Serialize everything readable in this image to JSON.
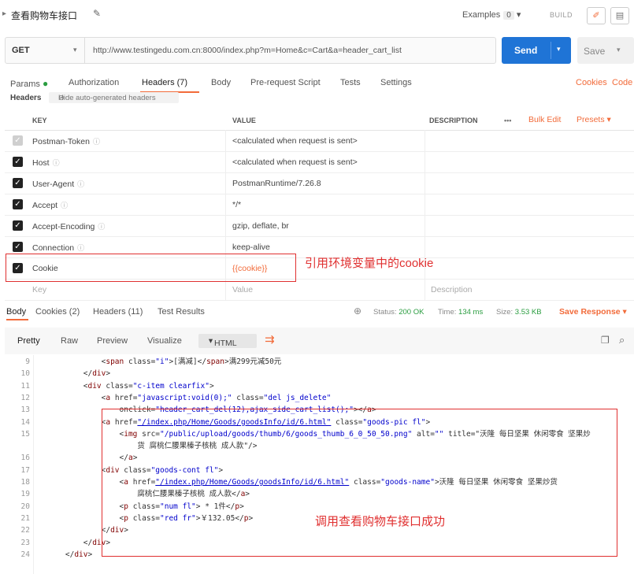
{
  "request": {
    "title": "查看购物车接口",
    "examples_label": "Examples",
    "examples_count": "0",
    "build_label": "BUILD",
    "method": "GET",
    "url": "http://www.testingedu.com.cn:8000/index.php?m=Home&c=Cart&a=header_cart_list",
    "send_label": "Send",
    "save_label": "Save"
  },
  "tabs": {
    "params": "Params",
    "authorization": "Authorization",
    "headers": "Headers (7)",
    "body": "Body",
    "prerequest": "Pre-request Script",
    "tests": "Tests",
    "settings": "Settings",
    "cookies_link": "Cookies",
    "code_link": "Code"
  },
  "headers_section": {
    "label": "Headers",
    "hide_auto": "Hide auto-generated headers"
  },
  "table": {
    "col_key": "KEY",
    "col_value": "VALUE",
    "col_description": "DESCRIPTION",
    "more": "•••",
    "bulk_edit": "Bulk Edit",
    "presets": "Presets",
    "rows": [
      {
        "key": "Postman-Token",
        "value": "<calculated when request is sent>"
      },
      {
        "key": "Host",
        "value": "<calculated when request is sent>"
      },
      {
        "key": "User-Agent",
        "value": "PostmanRuntime/7.26.8"
      },
      {
        "key": "Accept",
        "value": "*/*"
      },
      {
        "key": "Accept-Encoding",
        "value": "gzip, deflate, br"
      },
      {
        "key": "Connection",
        "value": "keep-alive"
      },
      {
        "key": "Cookie",
        "value": "{{cookie}}"
      }
    ],
    "placeholder_key": "Key",
    "placeholder_value": "Value",
    "placeholder_description": "Description"
  },
  "annotation_cookie": "引用环境变量中的cookie",
  "response": {
    "tab_body": "Body",
    "tab_cookies": "Cookies (2)",
    "tab_headers": "Headers (11)",
    "tab_tests": "Test Results",
    "status_label": "Status:",
    "status_value": "200 OK",
    "time_label": "Time:",
    "time_value": "134 ms",
    "size_label": "Size:",
    "size_value": "3.53 KB",
    "save_response": "Save Response",
    "view_pretty": "Pretty",
    "view_raw": "Raw",
    "view_preview": "Preview",
    "view_visualize": "Visualize",
    "format": "HTML"
  },
  "code_lines": [
    {
      "n": "9",
      "t": "            <span class=\"i\">[满减]</span>满299元减50元"
    },
    {
      "n": "10",
      "t": "        </div>"
    },
    {
      "n": "11",
      "t": "        <div class=\"c-item clearfix\">"
    },
    {
      "n": "12",
      "t": "            <a href=\"javascript:void(0);\" class=\"del js_delete\""
    },
    {
      "n": "13",
      "t": "                onclick=\"header_cart_del(12),ajax_side_cart_list();\"></a>"
    },
    {
      "n": "14",
      "t": "            <a href=\"/index.php/Home/Goods/goodsInfo/id/6.html\" class=\"goods-pic fl\">"
    },
    {
      "n": "15",
      "t": "                <img src=\"/public/upload/goods/thumb/6/goods_thumb_6_0_50_50.png\" alt=\"\" title=\"沃隆 每日坚果 休闲零食 坚果炒"
    },
    {
      "n": "",
      "t": "                    货 腐桃仁腰果榛子核桃 成人款\"/>"
    },
    {
      "n": "16",
      "t": "                </a>"
    },
    {
      "n": "17",
      "t": "            <div class=\"goods-cont fl\">"
    },
    {
      "n": "18",
      "t": "                <a href=\"/index.php/Home/Goods/goodsInfo/id/6.html\" class=\"goods-name\">沃隆 每日坚果 休闲零食 坚果炒货"
    },
    {
      "n": "19",
      "t": "                    腐桃仁腰果榛子核桃 成人款</a>"
    },
    {
      "n": "20",
      "t": "                <p class=\"num fl\"> * 1件</p>"
    },
    {
      "n": "21",
      "t": "                <p class=\"red fr\">￥132.05</p>"
    },
    {
      "n": "22",
      "t": "            </div>"
    },
    {
      "n": "23",
      "t": "        </div>"
    },
    {
      "n": "24",
      "t": "    </div>"
    }
  ],
  "annotation_response": "调用查看购物车接口成功"
}
